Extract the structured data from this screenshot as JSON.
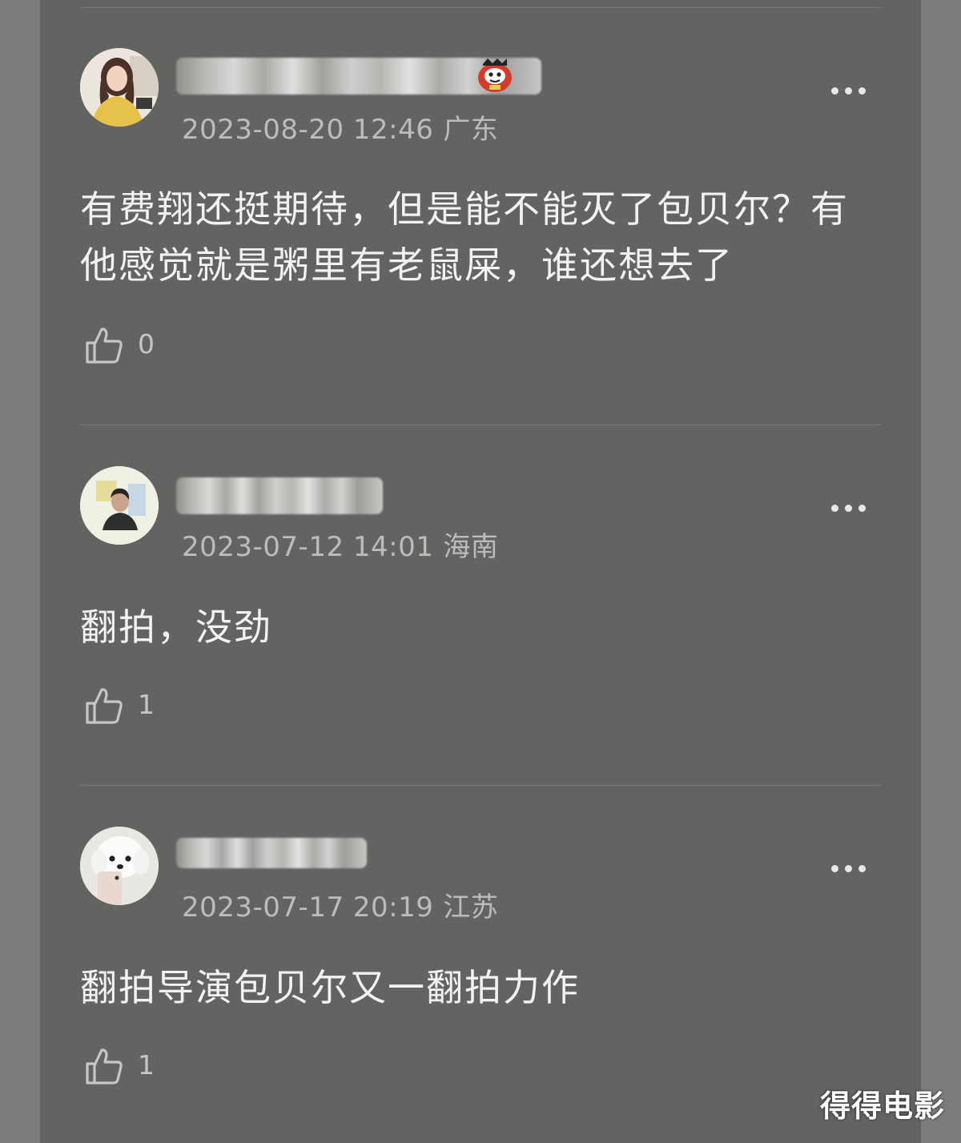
{
  "colors": {
    "page_background": "#7b7d7b",
    "panel_background": "#626461",
    "primary_text": "#f2f2f1",
    "secondary_text": "#bcbdbb",
    "divider": "#777976"
  },
  "comments": [
    {
      "avatar_icon": "avatar-woman-yellow-sweater",
      "username_obscured": true,
      "badge_icon": "red-lucky-cat-badge",
      "date": "2023-08-20 12:46",
      "location": "广东",
      "text_line1": "有费翔还挺期待，但是能不能灭了包贝尔？有",
      "text_line2": "他感觉就是粥里有老鼠屎，谁还想去了",
      "likes": "0"
    },
    {
      "avatar_icon": "avatar-young-man",
      "username_obscured": true,
      "date": "2023-07-12 14:01",
      "location": "海南",
      "text_line1": "翻拍，没劲",
      "likes": "1"
    },
    {
      "avatar_icon": "avatar-white-dog",
      "username_obscured": true,
      "date": "2023-07-17 20:19",
      "location": "江苏",
      "text_line1": "翻拍导演包贝尔又一翻拍力作",
      "likes": "1"
    }
  ],
  "watermark": "得得电影"
}
